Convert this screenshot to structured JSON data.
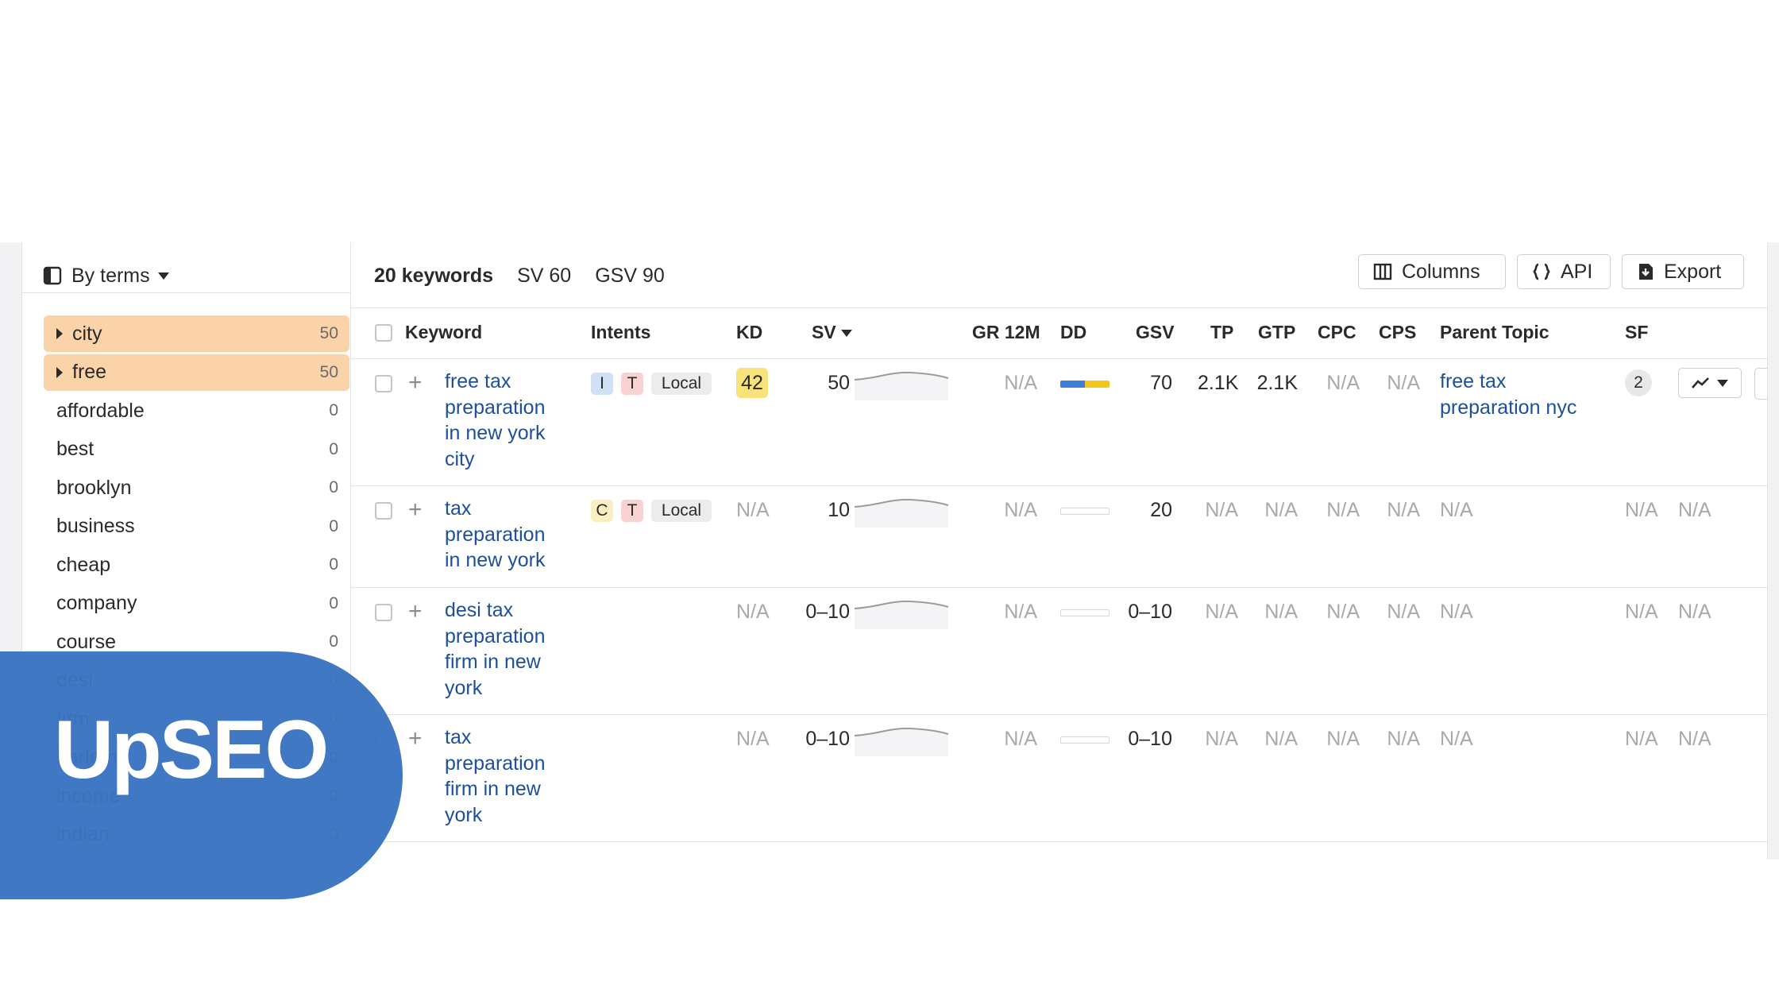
{
  "sidebar": {
    "title": "By terms",
    "terms": [
      {
        "label": "city",
        "count": "50",
        "highlight": true
      },
      {
        "label": "free",
        "count": "50",
        "highlight": true
      },
      {
        "label": "affordable",
        "count": "0"
      },
      {
        "label": "best",
        "count": "0"
      },
      {
        "label": "brooklyn",
        "count": "0"
      },
      {
        "label": "business",
        "count": "0"
      },
      {
        "label": "cheap",
        "count": "0"
      },
      {
        "label": "company",
        "count": "0"
      },
      {
        "label": "course",
        "count": "0"
      },
      {
        "label": "desi",
        "count": "0"
      },
      {
        "label": "firm",
        "count": "0"
      },
      {
        "label": "harlem",
        "count": "0"
      },
      {
        "label": "income",
        "count": "0"
      },
      {
        "label": "indian",
        "count": "0"
      }
    ]
  },
  "summary": {
    "keywords": "20 keywords",
    "sv": "SV 60",
    "gsv": "GSV 90"
  },
  "toolbar": {
    "columns": "Columns",
    "api": "API",
    "export": "Export"
  },
  "columns": {
    "keyword": "Keyword",
    "intents": "Intents",
    "kd": "KD",
    "sv": "SV",
    "gr": "GR 12M",
    "dd": "DD",
    "gsv": "GSV",
    "tp": "TP",
    "gtp": "GTP",
    "cpc": "CPC",
    "cps": "CPS",
    "parent": "Parent Topic",
    "sf": "SF"
  },
  "rows": [
    {
      "keyword": "free tax preparation in new york city",
      "intents": [
        "I",
        "T",
        "Local"
      ],
      "kd": "42",
      "sv": "50",
      "gr": "N/A",
      "gsv": "70",
      "tp": "2.1K",
      "gtp": "2.1K",
      "cpc": "N/A",
      "cps": "N/A",
      "parent": "free tax preparation nyc",
      "sf": "2"
    },
    {
      "keyword": "tax preparation in new york",
      "intents": [
        "C",
        "T",
        "Local"
      ],
      "kd": "N/A",
      "sv": "10",
      "gr": "N/A",
      "gsv": "20",
      "tp": "N/A",
      "gtp": "N/A",
      "cpc": "N/A",
      "cps": "N/A",
      "parent": "N/A",
      "sf": "N/A",
      "extra": "N/A"
    },
    {
      "keyword": "desi tax preparation firm in new york",
      "intents": [],
      "kd": "N/A",
      "sv": "0–10",
      "gr": "N/A",
      "gsv": "0–10",
      "tp": "N/A",
      "gtp": "N/A",
      "cpc": "N/A",
      "cps": "N/A",
      "parent": "N/A",
      "sf": "N/A",
      "extra": "N/A"
    },
    {
      "keyword": "tax preparation firm in new york",
      "intents": [],
      "kd": "N/A",
      "sv": "0–10",
      "gr": "N/A",
      "gsv": "0–10",
      "tp": "N/A",
      "gtp": "N/A",
      "cpc": "N/A",
      "cps": "N/A",
      "parent": "N/A",
      "sf": "N/A",
      "extra": "N/A"
    }
  ],
  "brand": {
    "logo_text": "UpSEO",
    "color": "#3a74c1"
  },
  "colors": {
    "link": "#1d4f9a",
    "highlight": "#fbd3a8",
    "kd_yellow": "#f7e27c",
    "dd_blue": "#3b7fd6",
    "dd_yellow": "#f4c51b"
  }
}
